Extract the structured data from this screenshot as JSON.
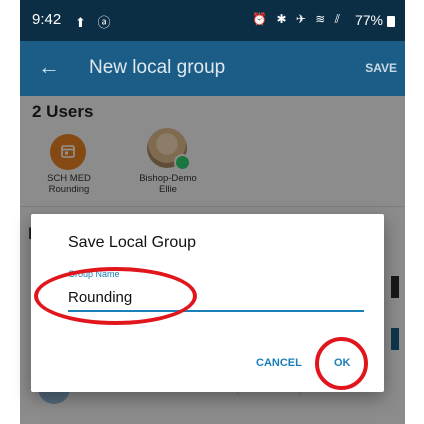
{
  "status_bar": {
    "time": "9:42",
    "left_icons": "⬆ ⓐ",
    "right_icons": "⏰ ✱ ✈ ≋ ⫽",
    "battery": "77%"
  },
  "app_bar": {
    "back_icon": "←",
    "title": "New local group",
    "save_label": "SAVE"
  },
  "users": {
    "count_label": "2 Users",
    "items": [
      {
        "label_line1": "SCH MED",
        "label_line2": "Rounding"
      },
      {
        "label_line1": "Bishop-Demo",
        "label_line2": "Ellie"
      }
    ]
  },
  "section": {
    "heading_partial": "P"
  },
  "background_list": {
    "visible_row_text": "Critical Care Unit 6002 (2nd floor)"
  },
  "dialog": {
    "title": "Save Local Group",
    "field_label": "Group Name",
    "field_value": "Rounding",
    "cancel_label": "CANCEL",
    "ok_label": "OK"
  },
  "colors": {
    "status_bar": "#0c2e44",
    "app_bar": "#1b5d86",
    "accent": "#1b7fb8",
    "avatar_orange": "#e67e22",
    "online": "#2ecc71",
    "highlight_red": "#e1161d"
  }
}
